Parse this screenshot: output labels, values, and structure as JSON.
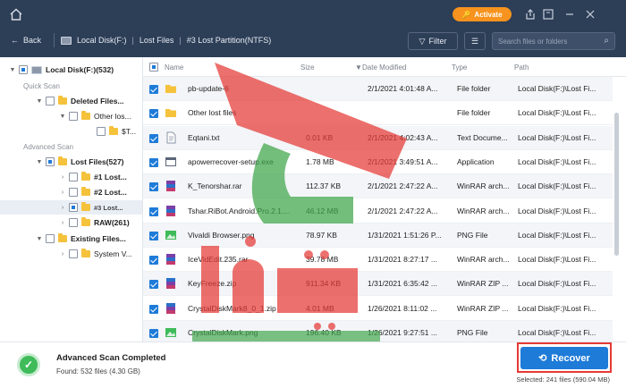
{
  "topbar": {
    "activate_label": "Activate",
    "back_label": "Back",
    "breadcrumb": [
      "Local Disk(F:)",
      "Lost Files",
      "#3 Lost Partition(NTFS)"
    ],
    "filter_label": "Filter",
    "search_placeholder": "Search files or folders"
  },
  "sidebar": {
    "root_label": "Local Disk(F:)(532)",
    "quick_scan_label": "Quick Scan",
    "advanced_scan_label": "Advanced Scan",
    "items": [
      {
        "label": "Deleted Files..."
      },
      {
        "label": "Other los..."
      },
      {
        "label": "$T..."
      },
      {
        "label": "Lost Files(527)"
      },
      {
        "label": "#1 Lost..."
      },
      {
        "label": "#2 Lost..."
      },
      {
        "label": "#3 Lost..."
      },
      {
        "label": "RAW(261)"
      },
      {
        "label": "Existing Files..."
      },
      {
        "label": "System V..."
      }
    ]
  },
  "list": {
    "headers": {
      "name": "Name",
      "size": "Size",
      "date": "Date Modified",
      "type": "Type",
      "path": "Path"
    },
    "rows": [
      {
        "icon": "folder-icon",
        "name": "pb-update-6",
        "size": "",
        "date": "2/1/2021 4:01:48 A...",
        "type": "File folder",
        "path": "Local Disk(F:)\\Lost Fi..."
      },
      {
        "icon": "folder-icon",
        "name": "Other lost files",
        "size": "",
        "date": "",
        "type": "File folder",
        "path": "Local Disk(F:)\\Lost Fi..."
      },
      {
        "icon": "text-file-icon",
        "name": "Eqtani.txt",
        "size": "0.01 KB",
        "date": "2/1/2021 4:02:43 A...",
        "type": "Text Docume...",
        "path": "Local Disk(F:)\\Lost Fi..."
      },
      {
        "icon": "exe-file-icon",
        "name": "apowerrecover-setup.exe",
        "size": "1.78 MB",
        "date": "2/1/2021 3:49:51 A...",
        "type": "Application",
        "path": "Local Disk(F:)\\Lost Fi..."
      },
      {
        "icon": "rar-file-icon",
        "name": "K_Tenorshar.rar",
        "size": "112.37 KB",
        "date": "2/1/2021 2:47:22 A...",
        "type": "WinRAR arch...",
        "path": "Local Disk(F:)\\Lost Fi..."
      },
      {
        "icon": "rar-file-icon",
        "name": "Tshar.RiBot.Android.Pro.2.1....",
        "size": "46.12 MB",
        "date": "2/1/2021 2:47:22 A...",
        "type": "WinRAR arch...",
        "path": "Local Disk(F:)\\Lost Fi..."
      },
      {
        "icon": "image-file-icon",
        "name": "Vivaldi Browser.png",
        "size": "78.97 KB",
        "date": "1/31/2021 1:51:26 P...",
        "type": "PNG File",
        "path": "Local Disk(F:)\\Lost Fi..."
      },
      {
        "icon": "rar-file-icon",
        "name": "IceVidEdit.235.rar",
        "size": "39.78 MB",
        "date": "1/31/2021 8:27:17 ...",
        "type": "WinRAR arch...",
        "path": "Local Disk(F:)\\Lost Fi..."
      },
      {
        "icon": "zip-file-icon",
        "name": "KeyFreeze.zip",
        "size": "911.34 KB",
        "date": "1/31/2021 6:35:42 ...",
        "type": "WinRAR ZIP ...",
        "path": "Local Disk(F:)\\Lost Fi..."
      },
      {
        "icon": "zip-file-icon",
        "name": "CrystalDiskMark8_0_1.zip",
        "size": "4.01 MB",
        "date": "1/26/2021 8:11:02 ...",
        "type": "WinRAR ZIP ...",
        "path": "Local Disk(F:)\\Lost Fi..."
      },
      {
        "icon": "image-file-icon",
        "name": "CrystalDiskMark.png",
        "size": "196.40 KB",
        "date": "1/26/2021 9:27:51 ...",
        "type": "PNG File",
        "path": "Local Disk(F:)\\Lost Fi..."
      }
    ]
  },
  "footer": {
    "title": "Advanced Scan Completed",
    "found": "Found: 532 files (4.30 GB)",
    "recover_label": "Recover",
    "selected": "Selected: 241 files (590.04 MB)"
  },
  "colors": {
    "topbar": "#2d3e57",
    "accent": "#1e7bd8",
    "activate": "#f7931e",
    "success": "#3fbb5a",
    "highlight": "#e53935"
  }
}
